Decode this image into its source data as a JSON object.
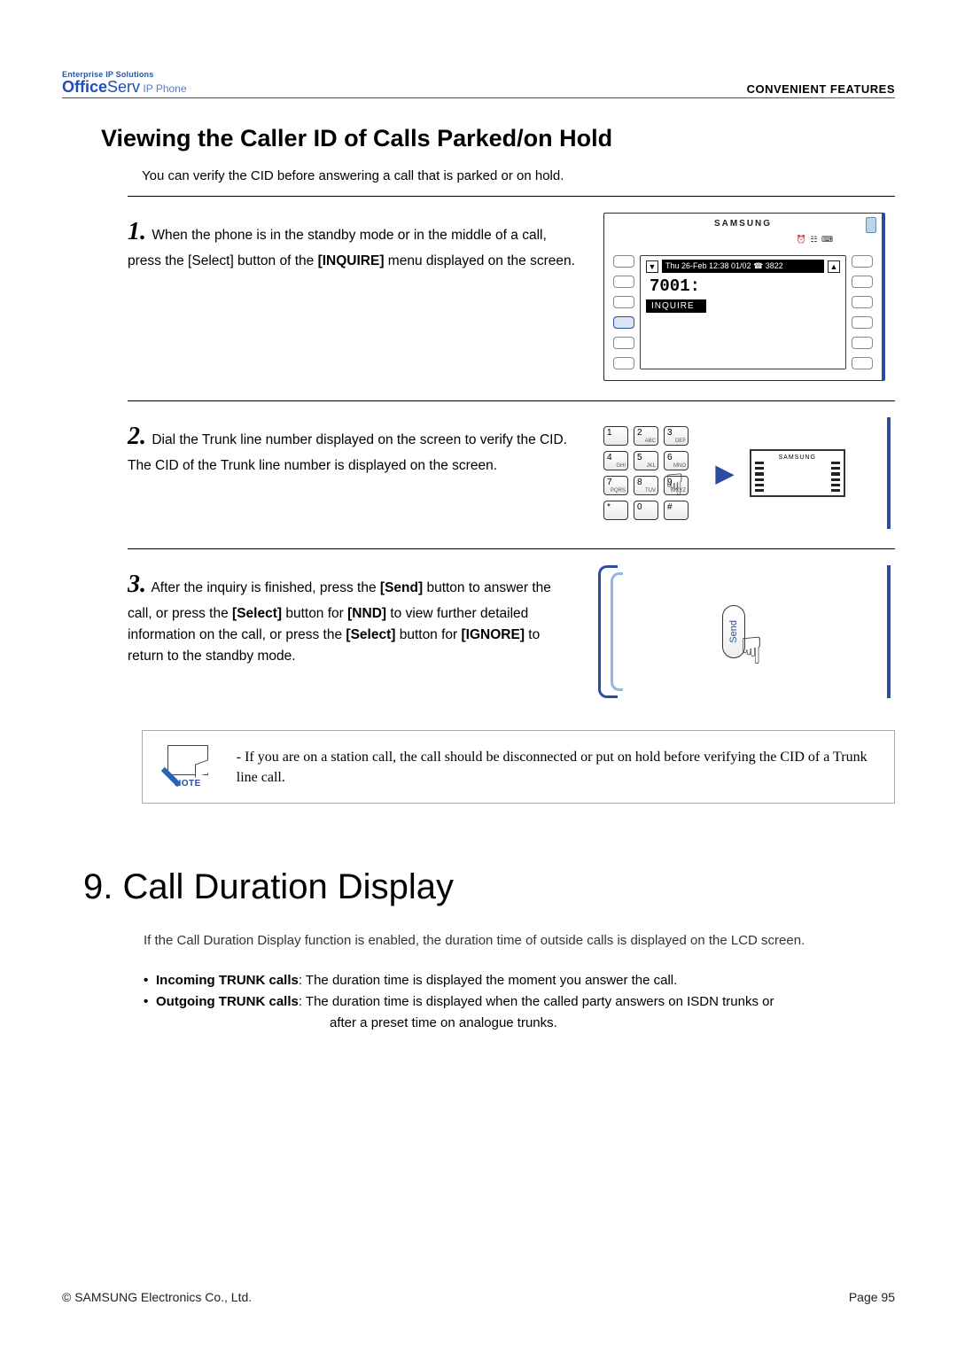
{
  "header": {
    "tag": "Enterprise IP Solutions",
    "product_bold": "Office",
    "product_rest": "Serv",
    "product_suffix": " IP Phone",
    "right": "CONVENIENT FEATURES"
  },
  "section_title": "Viewing the Caller ID of Calls Parked/on Hold",
  "intro": "You can verify the CID before answering a call that is parked or on hold.",
  "step1": {
    "num": "1",
    "t1": "When the phone is in the standby mode or in the middle of a call, press the [Select] button of the ",
    "b1": "[INQUIRE]",
    "t2": " menu displayed on the screen.",
    "lcd_brand": "SAMSUNG",
    "lcd_icons": "⏰ ☷ ⌨",
    "lcd_bar": "Thu 26-Feb 12:38  01/02 ☎ 3822",
    "lcd_ext": "7001:",
    "lcd_menu": "INQUIRE"
  },
  "step2": {
    "num": "2",
    "t1": "Dial the Trunk line number displayed on the screen to verify the CID.\nThe CID of the Trunk line number is displayed on the screen.",
    "keys": [
      "1",
      "2",
      "3",
      "4",
      "5",
      "6",
      "7",
      "8",
      "9",
      "*",
      "0",
      "#"
    ],
    "mini_label": "SAMSUNG"
  },
  "step3": {
    "num": "3",
    "t1": "After the inquiry is finished, press the ",
    "b1": "[Send]",
    "t2": " button to answer the call, or press the ",
    "b2": "[Select]",
    "t3": " button for ",
    "b3": "[NND]",
    "t4": " to view further detailed information on the call, or press the ",
    "b4": "[Select]",
    "t5": " button for ",
    "b5": "[IGNORE]",
    "t6": " to return to the standby mode.",
    "send_label": "Send"
  },
  "note": {
    "label": "NOTE",
    "text": "- If you are on a station call, the call should be disconnected or put on hold before verifying the CID of a Trunk line call."
  },
  "chapter_title": "9. Call Duration Display",
  "chapter_intro": "If the Call Duration Display function is enabled, the duration time of outside calls is displayed on the LCD screen.",
  "bullets": {
    "in_label": "Incoming TRUNK calls",
    "in_desc": " : The duration time is displayed the moment you answer the call.",
    "out_label": "Outgoing TRUNK calls",
    "out_desc": " : The duration time is displayed when the called party answers on ISDN trunks or",
    "out_cont": "after a preset time on analogue trunks."
  },
  "footer": {
    "left": "© SAMSUNG Electronics Co., Ltd.",
    "right": "Page 95"
  }
}
